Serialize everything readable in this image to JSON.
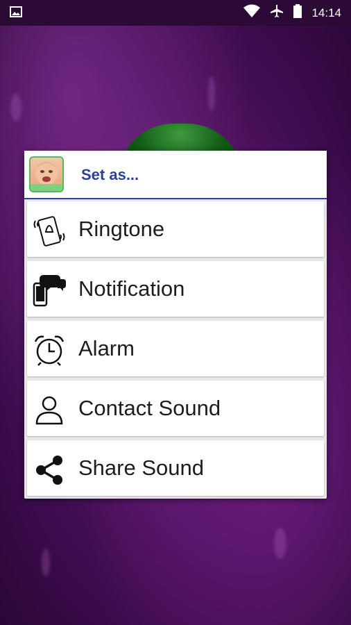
{
  "status_bar": {
    "time": "14:14"
  },
  "dialog": {
    "title": "Set as...",
    "items": [
      {
        "label": "Ringtone",
        "icon": "phone-ring-icon"
      },
      {
        "label": "Notification",
        "icon": "notification-icon"
      },
      {
        "label": "Alarm",
        "icon": "alarm-clock-icon"
      },
      {
        "label": "Contact Sound",
        "icon": "contact-icon"
      },
      {
        "label": "Share Sound",
        "icon": "share-icon"
      }
    ]
  },
  "colors": {
    "accent": "#2f3f95",
    "background": "#4a1060"
  }
}
